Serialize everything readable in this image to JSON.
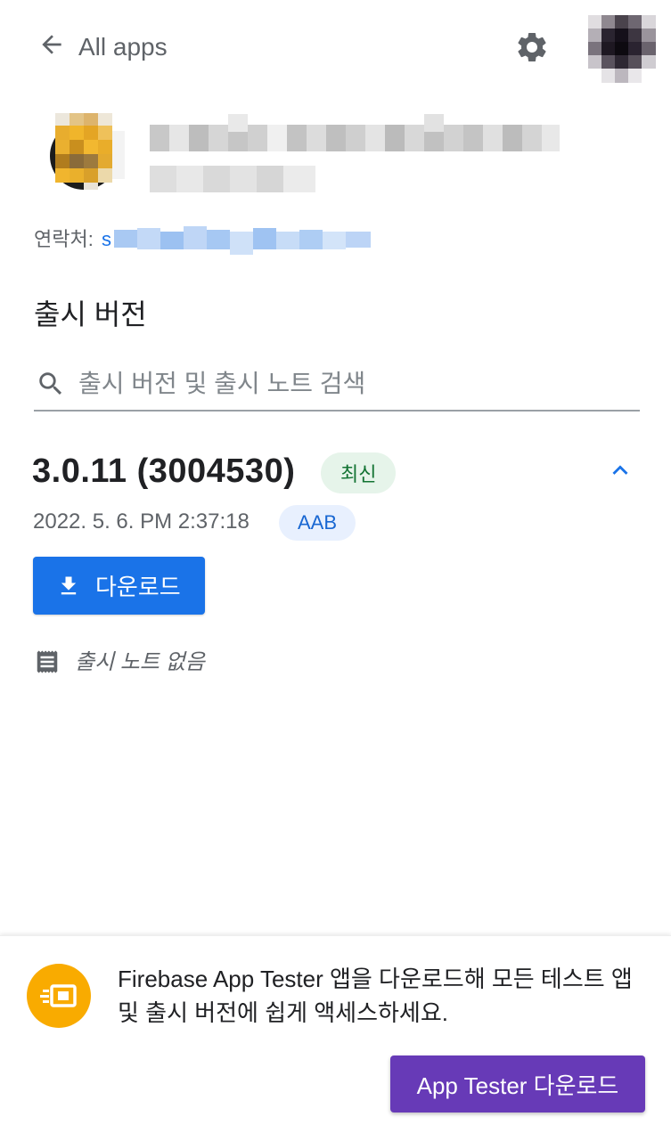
{
  "topbar": {
    "back_label": "All apps",
    "back_icon": "arrow-left-icon",
    "settings_icon": "gear-icon"
  },
  "app": {
    "contact_label": "연락처:",
    "contact_link_prefix": "s"
  },
  "releases": {
    "section_title": "출시 버전",
    "search_placeholder": "출시 버전 및 출시 노트 검색",
    "items": [
      {
        "version": "3.0.11 (3004530)",
        "latest_badge": "최신",
        "date": "2022. 5. 6. PM 2:37:18",
        "format_badge": "AAB",
        "download_label": "다운로드",
        "notes": "출시 노트 없음"
      }
    ]
  },
  "banner": {
    "text": "Firebase App Tester 앱을 다운로드해 모든 테스트 앱 및 출시 버전에 쉽게 액세스하세요.",
    "button_label": "App Tester 다운로드"
  },
  "colors": {
    "primary": "#1a73e8",
    "app_tester_button": "#673ab7",
    "promo_icon_bg": "#f9ab00",
    "latest_badge_bg": "#e6f4ea",
    "latest_badge_text": "#137333",
    "aab_badge_bg": "#e8f0fe",
    "aab_badge_text": "#1967d2"
  }
}
